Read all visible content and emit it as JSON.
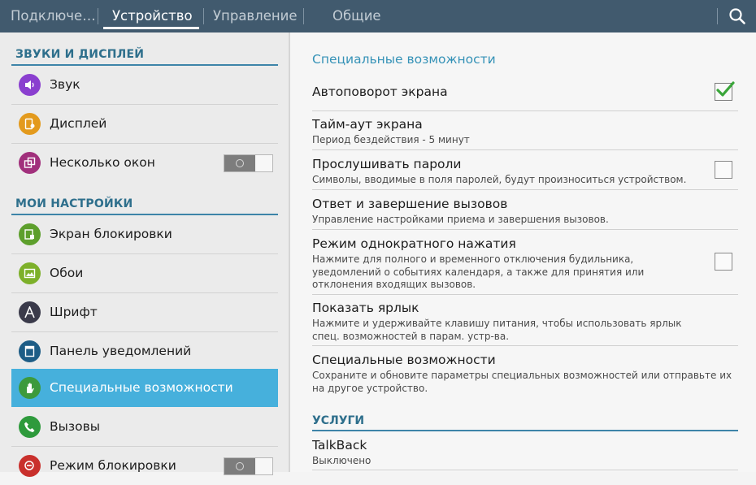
{
  "tabs": [
    {
      "label": "Подключе…",
      "active": false
    },
    {
      "label": "Устройство",
      "active": true
    },
    {
      "label": "Управление",
      "active": false
    },
    {
      "label": "Общие",
      "active": false
    }
  ],
  "search_icon": "search-icon",
  "colors": {
    "topbar": "#415a6e",
    "accent": "#46b0dc",
    "section_text": "#2e6f8c",
    "checkbox_check": "#3aa63a"
  },
  "left": {
    "section1": "ЗВУКИ И ДИСПЛЕЙ",
    "section2": "МОИ НАСТРОЙКИ",
    "items": [
      {
        "label": "Звук",
        "icon": "speaker-icon",
        "color": "#8a3fcf"
      },
      {
        "label": "Дисплей",
        "icon": "display-icon",
        "color": "#e39a1d"
      },
      {
        "label": "Несколько окон",
        "icon": "multi-window-icon",
        "color": "#a1307c",
        "toggle": "off"
      },
      {
        "label": "Экран блокировки",
        "icon": "lock-screen-icon",
        "color": "#5d9f2c"
      },
      {
        "label": "Обои",
        "icon": "wallpaper-icon",
        "color": "#7db02a"
      },
      {
        "label": "Шрифт",
        "icon": "font-icon",
        "color": "#3a3a4a"
      },
      {
        "label": "Панель уведомлений",
        "icon": "notification-panel-icon",
        "color": "#1e5d86"
      },
      {
        "label": "Специальные возможности",
        "icon": "accessibility-hand-icon",
        "color": "#3d9a3d",
        "selected": true
      },
      {
        "label": "Вызовы",
        "icon": "phone-icon",
        "color": "#2e9a3c"
      },
      {
        "label": "Режим блокировки",
        "icon": "block-mode-icon",
        "color": "#c9302c",
        "toggle": "off"
      }
    ]
  },
  "right": {
    "title": "Специальные возможности",
    "items": [
      {
        "title": "Автоповорот экрана",
        "subtitle": "",
        "checkbox": true
      },
      {
        "title": "Тайм-аут экрана",
        "subtitle": "Период бездействия - 5 минут"
      },
      {
        "title": "Прослушивать пароли",
        "subtitle": "Символы, вводимые в поля паролей, будут произноситься устройством.",
        "checkbox": false
      },
      {
        "title": "Ответ и завершение вызовов",
        "subtitle": "Управление настройками приема и завершения вызовов."
      },
      {
        "title": "Режим однократного нажатия",
        "subtitle": "Нажмите для полного и временного отключения будильника, уведомлений о событиях календаря, а также для принятия или отклонения входящих вызовов.",
        "checkbox": false
      },
      {
        "title": "Показать ярлык",
        "subtitle": "Нажмите и удерживайте клавишу питания, чтобы использовать ярлык спец. возможностей в парам. устр-ва."
      },
      {
        "title": "Специальные возможности",
        "subtitle": "Сохраните и обновите параметры специальных возможностей или отправьте их на другое устройство."
      }
    ],
    "section_services": "УСЛУГИ",
    "talkback": {
      "title": "TalkBack",
      "subtitle": "Выключено"
    }
  }
}
